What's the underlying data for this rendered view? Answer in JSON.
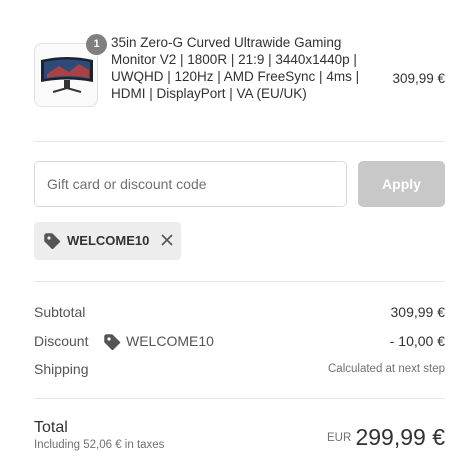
{
  "product": {
    "quantity": "1",
    "title": "35in Zero-G Curved Ultrawide Gaming Monitor V2 | 1800R | 21:9 | 3440x1440p | UWQHD | 120Hz | AMD FreeSync | 4ms | HDMI | DisplayPort | VA (EU/UK)",
    "price": "309,99 €",
    "thumbnail_icon": "monitor-icon"
  },
  "discount_form": {
    "placeholder": "Gift card or discount code",
    "apply_label": "Apply"
  },
  "applied_code": {
    "code": "WELCOME10",
    "icon": "tag-icon",
    "remove_icon": "close-icon"
  },
  "summary": {
    "subtotal_label": "Subtotal",
    "subtotal_value": "309,99 €",
    "discount_label": "Discount",
    "discount_code": "WELCOME10",
    "discount_value": "- 10,00 €",
    "shipping_label": "Shipping",
    "shipping_value": "Calculated at next step"
  },
  "total": {
    "label": "Total",
    "tax_note": "Including 52,06 € in taxes",
    "currency": "EUR",
    "amount": "299,99 €"
  },
  "colors": {
    "apply_button_disabled": "#c8c8c8",
    "chip_background": "#ededed",
    "badge": "#7f7f7f"
  }
}
